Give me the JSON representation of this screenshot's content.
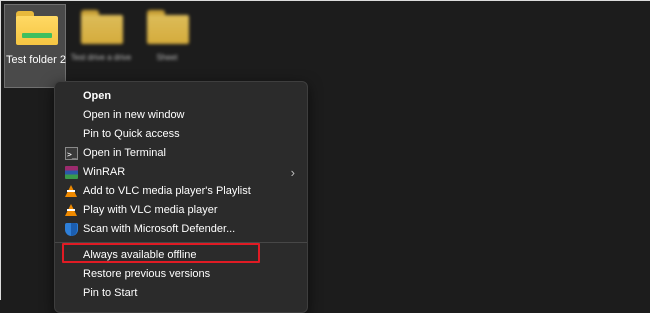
{
  "desktop": {
    "folders": [
      {
        "label": "Test folder 2",
        "selected": true
      },
      {
        "label": "Test drive a drive",
        "selected": false
      },
      {
        "label": "Sheet",
        "selected": false
      }
    ]
  },
  "context_menu": {
    "items": [
      {
        "label": "Open",
        "icon": "none",
        "bold": true
      },
      {
        "label": "Open in new window",
        "icon": "none"
      },
      {
        "label": "Pin to Quick access",
        "icon": "none"
      },
      {
        "label": "Open in Terminal",
        "icon": "terminal-icon"
      },
      {
        "label": "WinRAR",
        "icon": "winrar-icon",
        "submenu": true
      },
      {
        "label": "Add to VLC media player's Playlist",
        "icon": "vlc-icon"
      },
      {
        "label": "Play with VLC media player",
        "icon": "vlc-icon"
      },
      {
        "label": "Scan with Microsoft Defender...",
        "icon": "defender-shield-icon"
      },
      {
        "label": "Always available offline",
        "icon": "none",
        "highlighted": true
      },
      {
        "label": "Restore previous versions",
        "icon": "none"
      },
      {
        "label": "Pin to Start",
        "icon": "none"
      }
    ],
    "submenu_indicator": "›"
  },
  "colors": {
    "background": "#1c1c1c",
    "menu_background": "#2b2b2b",
    "highlight_box": "#e01b24",
    "folder_yellow": "#f5c542",
    "folder_green_stripe": "#3fbf5f"
  }
}
